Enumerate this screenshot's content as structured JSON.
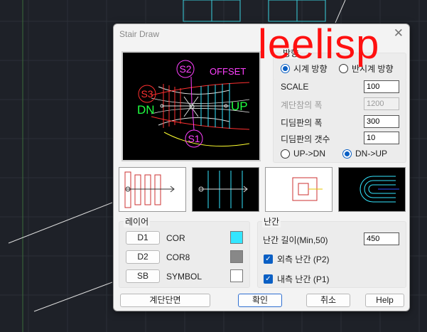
{
  "window": {
    "title": "Stair Draw",
    "close_glyph": "✕"
  },
  "watermark": "leelisp",
  "preview": {
    "labels": {
      "s1": "S1",
      "s2": "S2",
      "s3": "S3",
      "dn": "DN",
      "up": "UP",
      "offset": "OFFSET"
    }
  },
  "direction_group": {
    "label": "방향",
    "clockwise": {
      "label": "시계 방향",
      "selected": true
    },
    "counterclockwise": {
      "label": "반시계 방향",
      "selected": false
    }
  },
  "fields": {
    "scale": {
      "label": "SCALE",
      "value": "100",
      "enabled": true
    },
    "stair_width": {
      "label": "계단참의 폭",
      "value": "1200",
      "enabled": false
    },
    "tread_width": {
      "label": "디딤판의 폭",
      "value": "300",
      "enabled": true
    },
    "tread_count": {
      "label": "디딤판의 갯수",
      "value": "10",
      "enabled": true
    }
  },
  "updown": {
    "up_dn": {
      "label": "UP->DN",
      "selected": false
    },
    "dn_up": {
      "label": "DN->UP",
      "selected": true
    }
  },
  "layer_group": {
    "label": "레이어",
    "rows": [
      {
        "button": "D1",
        "name": "COR",
        "color": "#33e6ff"
      },
      {
        "button": "D2",
        "name": "COR8",
        "color": "#888888"
      },
      {
        "button": "SB",
        "name": "SYMBOL",
        "color": "#ffffff"
      }
    ]
  },
  "railing_group": {
    "label": "난간",
    "length_label": "난간 길이(Min,50)",
    "length_value": "450",
    "outer": {
      "label": "외측 난간 (P2)",
      "checked": true
    },
    "inner": {
      "label": "내측 난간 (P1)",
      "checked": true
    }
  },
  "buttons": {
    "section": "계단단면",
    "ok": "확인",
    "cancel": "취소",
    "help": "Help"
  },
  "colors": {
    "cad_bg": "#1e2128",
    "cad_cyan": "#33e6ff",
    "accent": "#0a5fc4",
    "watermark": "#ff1010"
  }
}
